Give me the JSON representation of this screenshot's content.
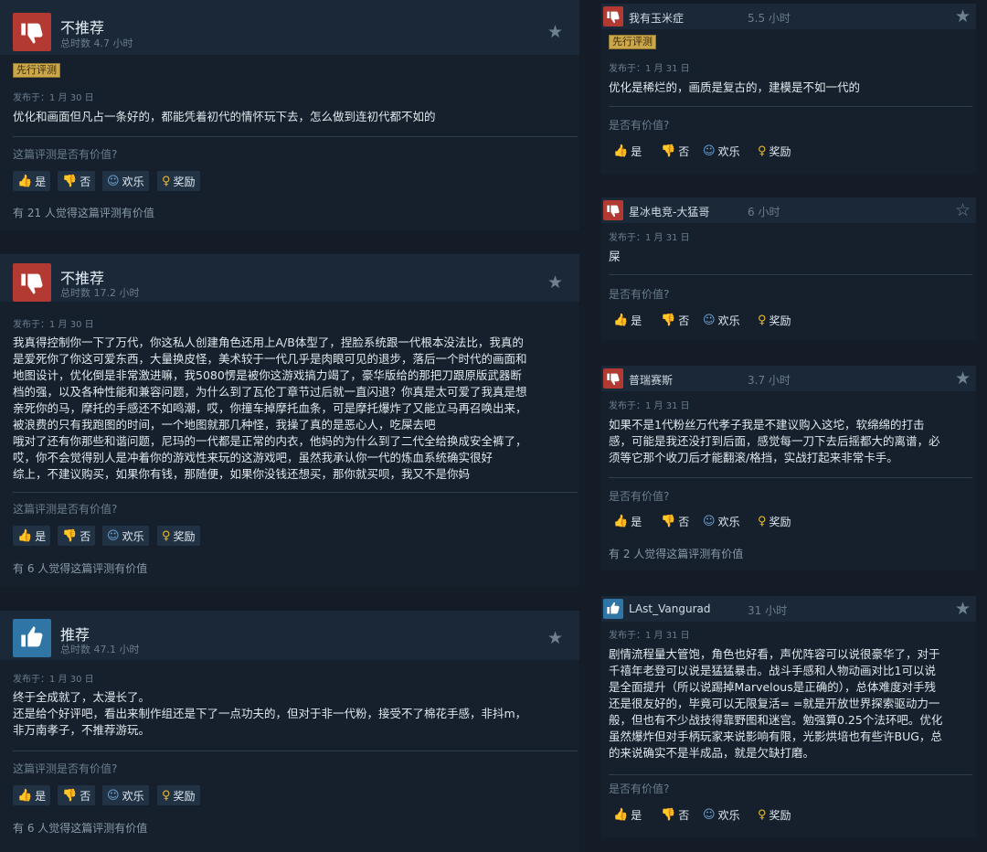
{
  "ui": {
    "posted_prefix": "发布于：",
    "helpful_question_left": "这篇评测是否有价值?",
    "helpful_question_right": "是否有价值?",
    "btn_yes": "是",
    "btn_no": "否",
    "btn_funny": "欢乐",
    "btn_award": "奖励",
    "early_access_badge": "先行评测"
  },
  "colors": {
    "not_recommended": "#b33a32",
    "recommended": "#2f75a6",
    "award_gold": "#e6b82b",
    "badge_gold": "#c9a74a"
  },
  "left_reviews": [
    {
      "verdict": "不推荐",
      "hours": "总时数 4.7 小时",
      "badge": "先行评测",
      "date": "1 月 30 日",
      "text": "优化和画面但凡占一条好的，都能凭着初代的情怀玩下去，怎么做到连初代都不如的",
      "helpful_count": "有 21 人觉得这篇评测有价值"
    },
    {
      "verdict": "不推荐",
      "hours": "总时数 17.2 小时",
      "date": "1 月 30 日",
      "lines": [
        "我真得控制你一下了万代，你这私人创建角色还用上A/B体型了，捏脸系统跟一代根本没法比，我真的",
        "是爱死你了你这可爱东西，大量换皮怪，美术较于一代几乎是肉眼可见的退步，落后一个时代的画面和",
        "地图设计，优化倒是非常激进嘛，我5080愣是被你这游戏搞力竭了，豪华版给的那把刀跟原版武器断",
        "档的强，以及各种性能和兼容问题，为什么到了瓦伦丁章节过后就一直闪退？你真是太可爱了我真是想",
        "亲死你的马，摩托的手感还不如鸣潮，哎，你撞车掉摩托血条，可是摩托爆炸了又能立马再召唤出来，",
        "被浪费的只有我跑图的时间，一个地图就那几种怪，我操了真的是恶心人，吃屎去吧",
        "哦对了还有你那些和谐问题，尼玛的一代都是正常的内衣，他妈的为什么到了二代全给换成安全裤了，",
        "哎，你不会觉得别人是冲着你的游戏性来玩的这游戏吧，虽然我承认你一代的炼血系统确实很好",
        "综上，不建议购买，如果你有钱，那随便，如果你没钱还想买，那你就买呗，我又不是你妈"
      ],
      "helpful_count": "有 6 人觉得这篇评测有价值"
    },
    {
      "verdict": "推荐",
      "hours": "总时数 47.1 小时",
      "date": "1 月 30 日",
      "lines": [
        "终于全成就了，太漫长了。",
        "还是给个好评吧，看出来制作组还是下了一点功夫的，但对于非一代粉，接受不了棉花手感，非抖m，",
        "非万南孝子，不推荐游玩。"
      ],
      "helpful_count": "有 6 人觉得这篇评测有价值"
    }
  ],
  "right_reviews": [
    {
      "username": "我有玉米症",
      "hours": "5.5 小时",
      "badge": "先行评测",
      "date": "1 月 31 日",
      "text": "优化是稀烂的，画质是复古的，建模是不如一代的"
    },
    {
      "username": "星冰电竞-大猛哥",
      "hours": "6 小时",
      "date": "1 月 31 日",
      "text": "屎"
    },
    {
      "username": "普瑞赛斯",
      "hours": "3.7 小时",
      "date": "1 月 31 日",
      "lines": [
        "如果不是1代粉丝万代孝子我是不建议购入这坨，软绵绵的打击",
        "感，可能是我还没打到后面，感觉每一刀下去后摇都大的离谱，必",
        "须等它那个收刀后才能翻滚/格挡，实战打起来非常卡手。"
      ],
      "helpful_count": "有 2 人觉得这篇评测有价值"
    },
    {
      "username": "LAst_Vangurad",
      "hours": "31 小时",
      "date": "1 月 31 日",
      "lines": [
        "剧情流程量大管饱，角色也好看，声优阵容可以说很豪华了，对于",
        "千禧年老登可以说是猛猛暴击。战斗手感和人物动画对比1可以说",
        "是全面提升（所以说踢掉Marvelous是正确的），总体难度对手残",
        "还是很友好的，毕竟可以无限复活= =就是开放世界探索驱动力一",
        "般，但也有不少战技得靠野图和迷宫。勉强算0.25个法环吧。优化",
        "虽然爆炸但对手柄玩家来说影响有限，光影烘培也有些许BUG，总",
        "的来说确实不是半成品，就是欠缺打磨。"
      ]
    }
  ]
}
